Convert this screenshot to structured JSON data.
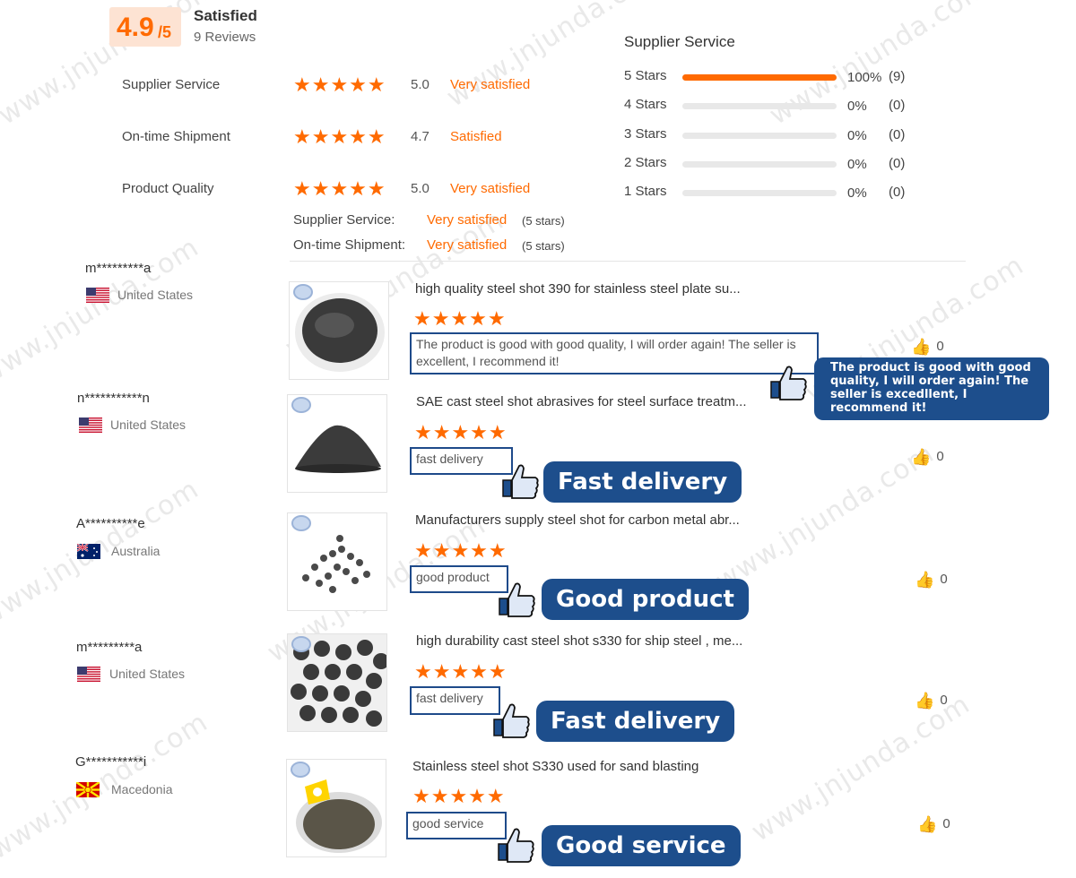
{
  "summary": {
    "score": "4.9",
    "score_max": "/5",
    "title": "Satisfied",
    "reviews": "9 Reviews"
  },
  "categories": [
    {
      "label": "Supplier Service",
      "stars": "★★★★★",
      "value": "5.0",
      "sat": "Very satisfied"
    },
    {
      "label": "On-time Shipment",
      "stars": "★★★★★",
      "value": "4.7",
      "sat": "Satisfied"
    },
    {
      "label": "Product Quality",
      "stars": "★★★★★",
      "value": "5.0",
      "sat": "Very satisfied"
    }
  ],
  "sub_ratings": [
    {
      "label": "Supplier Service:",
      "sat": "Very satisfied",
      "note": "(5 stars)"
    },
    {
      "label": "On-time Shipment:",
      "sat": "Very satisfied",
      "note": "(5 stars)"
    }
  ],
  "distribution": {
    "title": "Supplier Service",
    "rows": [
      {
        "label": "5  Stars",
        "pct": "100%",
        "count": "(9)",
        "fraction": 1.0
      },
      {
        "label": "4  Stars",
        "pct": "0%",
        "count": "(0)",
        "fraction": 0
      },
      {
        "label": "3  Stars",
        "pct": "0%",
        "count": "(0)",
        "fraction": 0
      },
      {
        "label": "2  Stars",
        "pct": "0%",
        "count": "(0)",
        "fraction": 0
      },
      {
        "label": "1  Stars",
        "pct": "0%",
        "count": "(0)",
        "fraction": 0
      }
    ]
  },
  "reviews": [
    {
      "user": "m*********a",
      "country": "United States",
      "product": "high quality steel shot 390 for stainless steel plate su...",
      "stars": "★★★★★",
      "text": "The product is good with good quality, I will order again! The seller is excellent, I recommend it!",
      "callout": "The product is good with good quality, I will order again! The seller is excedllent, I recommend it!",
      "likes": "0"
    },
    {
      "user": "n***********n",
      "country": "United States",
      "product": "SAE cast steel shot abrasives for steel surface treatm...",
      "stars": "★★★★★",
      "text": "fast delivery",
      "callout": "Fast delivery",
      "likes": "0"
    },
    {
      "user": "A**********e",
      "country": "Australia",
      "product": "Manufacturers supply steel shot for carbon metal abr...",
      "stars": "★★★★★",
      "text": "good product",
      "callout": "Good product",
      "likes": "0"
    },
    {
      "user": "m*********a",
      "country": "United States",
      "product": "high durability cast steel shot s330 for ship steel , me...",
      "stars": "★★★★★",
      "text": "fast delivery",
      "callout": "Fast delivery",
      "likes": "0"
    },
    {
      "user": "G***********i",
      "country": "Macedonia",
      "product": "Stainless steel shot S330 used for sand blasting",
      "stars": "★★★★★",
      "text": "good service",
      "callout": "Good service",
      "likes": "0"
    }
  ],
  "watermark": "www.jnjunda.com",
  "colors": {
    "accent": "#ff6a00",
    "callout": "#1d4e8c"
  }
}
